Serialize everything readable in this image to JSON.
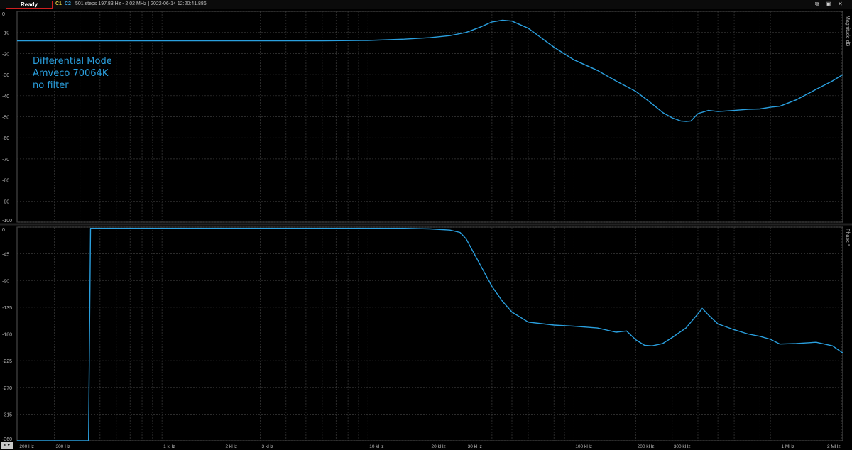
{
  "toolbar": {
    "status": "Ready",
    "channel1": "C1",
    "channel2": "C2",
    "sweep_info": "501 steps   197.83 Hz - 2.02 MHz  |  2022-06-14 12:20:41.886",
    "window_icons": [
      "⧉",
      "▣",
      "✕"
    ],
    "x_button": "x ▾"
  },
  "annotation": [
    "Differential Mode",
    "Amveco 70064K",
    "no filter"
  ],
  "colors": {
    "trace": "#2a9fde",
    "grid": "#3a3a3a",
    "background": "#000000"
  },
  "chart_data": [
    {
      "type": "line",
      "ylabel": "Magnitude dB",
      "ylim": [
        -100,
        0
      ],
      "yticks": [
        "0",
        "-10",
        "-20",
        "-30",
        "-40",
        "-50",
        "-60",
        "-70",
        "-80",
        "-90",
        "-100"
      ],
      "xscale": "log",
      "xlim_hz": [
        197.83,
        2020000
      ],
      "grid": true,
      "series": [
        {
          "x_hz": [
            197.83,
            1000,
            3000,
            6000,
            10000,
            15000,
            20000,
            25000,
            30000,
            35000,
            40000,
            45000,
            50000,
            60000,
            80000,
            100000,
            130000,
            160000,
            200000,
            230000,
            270000,
            300000,
            330000,
            350000,
            370000,
            400000,
            450000,
            500000,
            600000,
            700000,
            800000,
            900000,
            1000000,
            1200000,
            1500000,
            1800000,
            2020000
          ],
          "y_db": [
            -14,
            -14,
            -14,
            -14,
            -13.8,
            -13.2,
            -12.5,
            -11.5,
            -10,
            -7.5,
            -5,
            -4.2,
            -4.6,
            -8,
            -17,
            -23,
            -28,
            -33,
            -38,
            -42.5,
            -48,
            -50.5,
            -52,
            -52.2,
            -52,
            -48.5,
            -47,
            -47.5,
            -47,
            -46.5,
            -46.3,
            -45.5,
            -45,
            -42,
            -37,
            -33,
            -30
          ]
        }
      ]
    },
    {
      "type": "line",
      "ylabel": "Phase °",
      "ylim": [
        -360,
        0
      ],
      "yticks": [
        "0",
        "-45",
        "-90",
        "-135",
        "-180",
        "-225",
        "-270",
        "-315",
        "-360"
      ],
      "xscale": "log",
      "xlim_hz": [
        197.83,
        2020000
      ],
      "xticks": [
        "200 Hz",
        "300 Hz",
        "1 kHz",
        "2 kHz",
        "3 kHz",
        "10 kHz",
        "20 kHz",
        "30 kHz",
        "100 kHz",
        "200 kHz",
        "300 kHz",
        "1 MHz",
        "2 MHz"
      ],
      "grid": true,
      "series": [
        {
          "x_hz": [
            197.83,
            440,
            450,
            500,
            1000,
            3000,
            10000,
            15000,
            20000,
            25000,
            28000,
            30000,
            35000,
            40000,
            45000,
            50000,
            60000,
            80000,
            100000,
            130000,
            160000,
            180000,
            200000,
            220000,
            240000,
            270000,
            300000,
            350000,
            400000,
            420000,
            450000,
            500000,
            600000,
            700000,
            800000,
            900000,
            1000000,
            1200000,
            1500000,
            1800000,
            2020000
          ],
          "y_deg": [
            -360,
            -360,
            -2,
            -2,
            -2,
            -2,
            -2,
            -2,
            -3,
            -5,
            -9,
            -20,
            -63,
            -100,
            -125,
            -143,
            -160,
            -165,
            -167,
            -170,
            -177,
            -175,
            -190,
            -199,
            -200,
            -196,
            -186,
            -170,
            -146,
            -137,
            -148,
            -163,
            -173,
            -180,
            -184,
            -189,
            -197,
            -196,
            -194,
            -200,
            -212
          ]
        }
      ]
    }
  ]
}
